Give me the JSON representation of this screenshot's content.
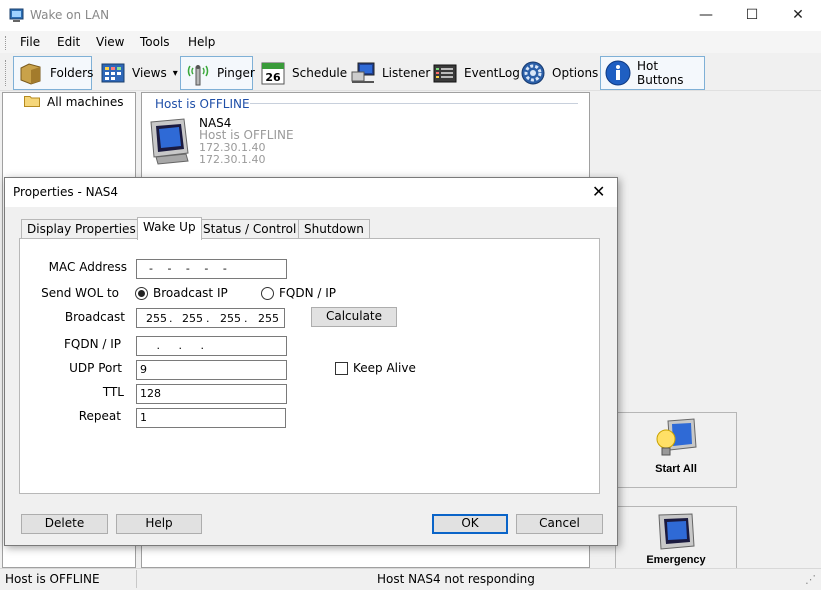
{
  "window": {
    "title": "Wake on LAN",
    "minimize": "—",
    "maximize": "☐",
    "close": "✕"
  },
  "menu": [
    "File",
    "Edit",
    "View",
    "Tools",
    "Help"
  ],
  "toolbar": {
    "folders": "Folders",
    "views": "Views",
    "views_arrow": "▾",
    "pinger": "Pinger",
    "schedule": "Schedule",
    "schedule_day": "26",
    "listener": "Listener",
    "eventlog": "EventLog",
    "options": "Options",
    "hot_buttons": "Hot Buttons"
  },
  "tree": {
    "root": "All machines"
  },
  "group": {
    "header": "Host is OFFLINE"
  },
  "host": {
    "name": "NAS4",
    "status": "Host is OFFLINE",
    "ip1": "172.30.1.40",
    "ip2": "172.30.1.40"
  },
  "hot_buttons": {
    "start_all": "Start All",
    "emergency": "Emergency"
  },
  "statusbar": {
    "left": "Host is OFFLINE",
    "middle": "Host NAS4 not responding",
    "grip": "⋰"
  },
  "dialog": {
    "title": "Properties - NAS4",
    "close": "✕",
    "tabs": [
      "Display Properties",
      "Wake Up",
      "Status / Control",
      "Shutdown"
    ],
    "active_tab": "Wake Up",
    "mac_label": "MAC Address",
    "mac_value": "  -   -   -   -   -",
    "send_wol_label": "Send WOL to",
    "radio_broadcast": "Broadcast IP",
    "radio_fqdn": "FQDN / IP",
    "selected_target": "Broadcast IP",
    "broadcast_label": "Broadcast",
    "broadcast_octets": [
      "255",
      "255",
      "255",
      "255"
    ],
    "octet_sep": ".",
    "calculate": "Calculate",
    "fqdn_label": "FQDN / IP",
    "fqdn_value": "   .   .   .",
    "udp_label": "UDP Port",
    "udp_value": "9",
    "keep_alive": "Keep Alive",
    "keep_alive_checked": false,
    "ttl_label": "TTL",
    "ttl_value": "128",
    "repeat_label": "Repeat",
    "repeat_value": "1",
    "delete": "Delete",
    "help": "Help",
    "ok": "OK",
    "cancel": "Cancel"
  }
}
